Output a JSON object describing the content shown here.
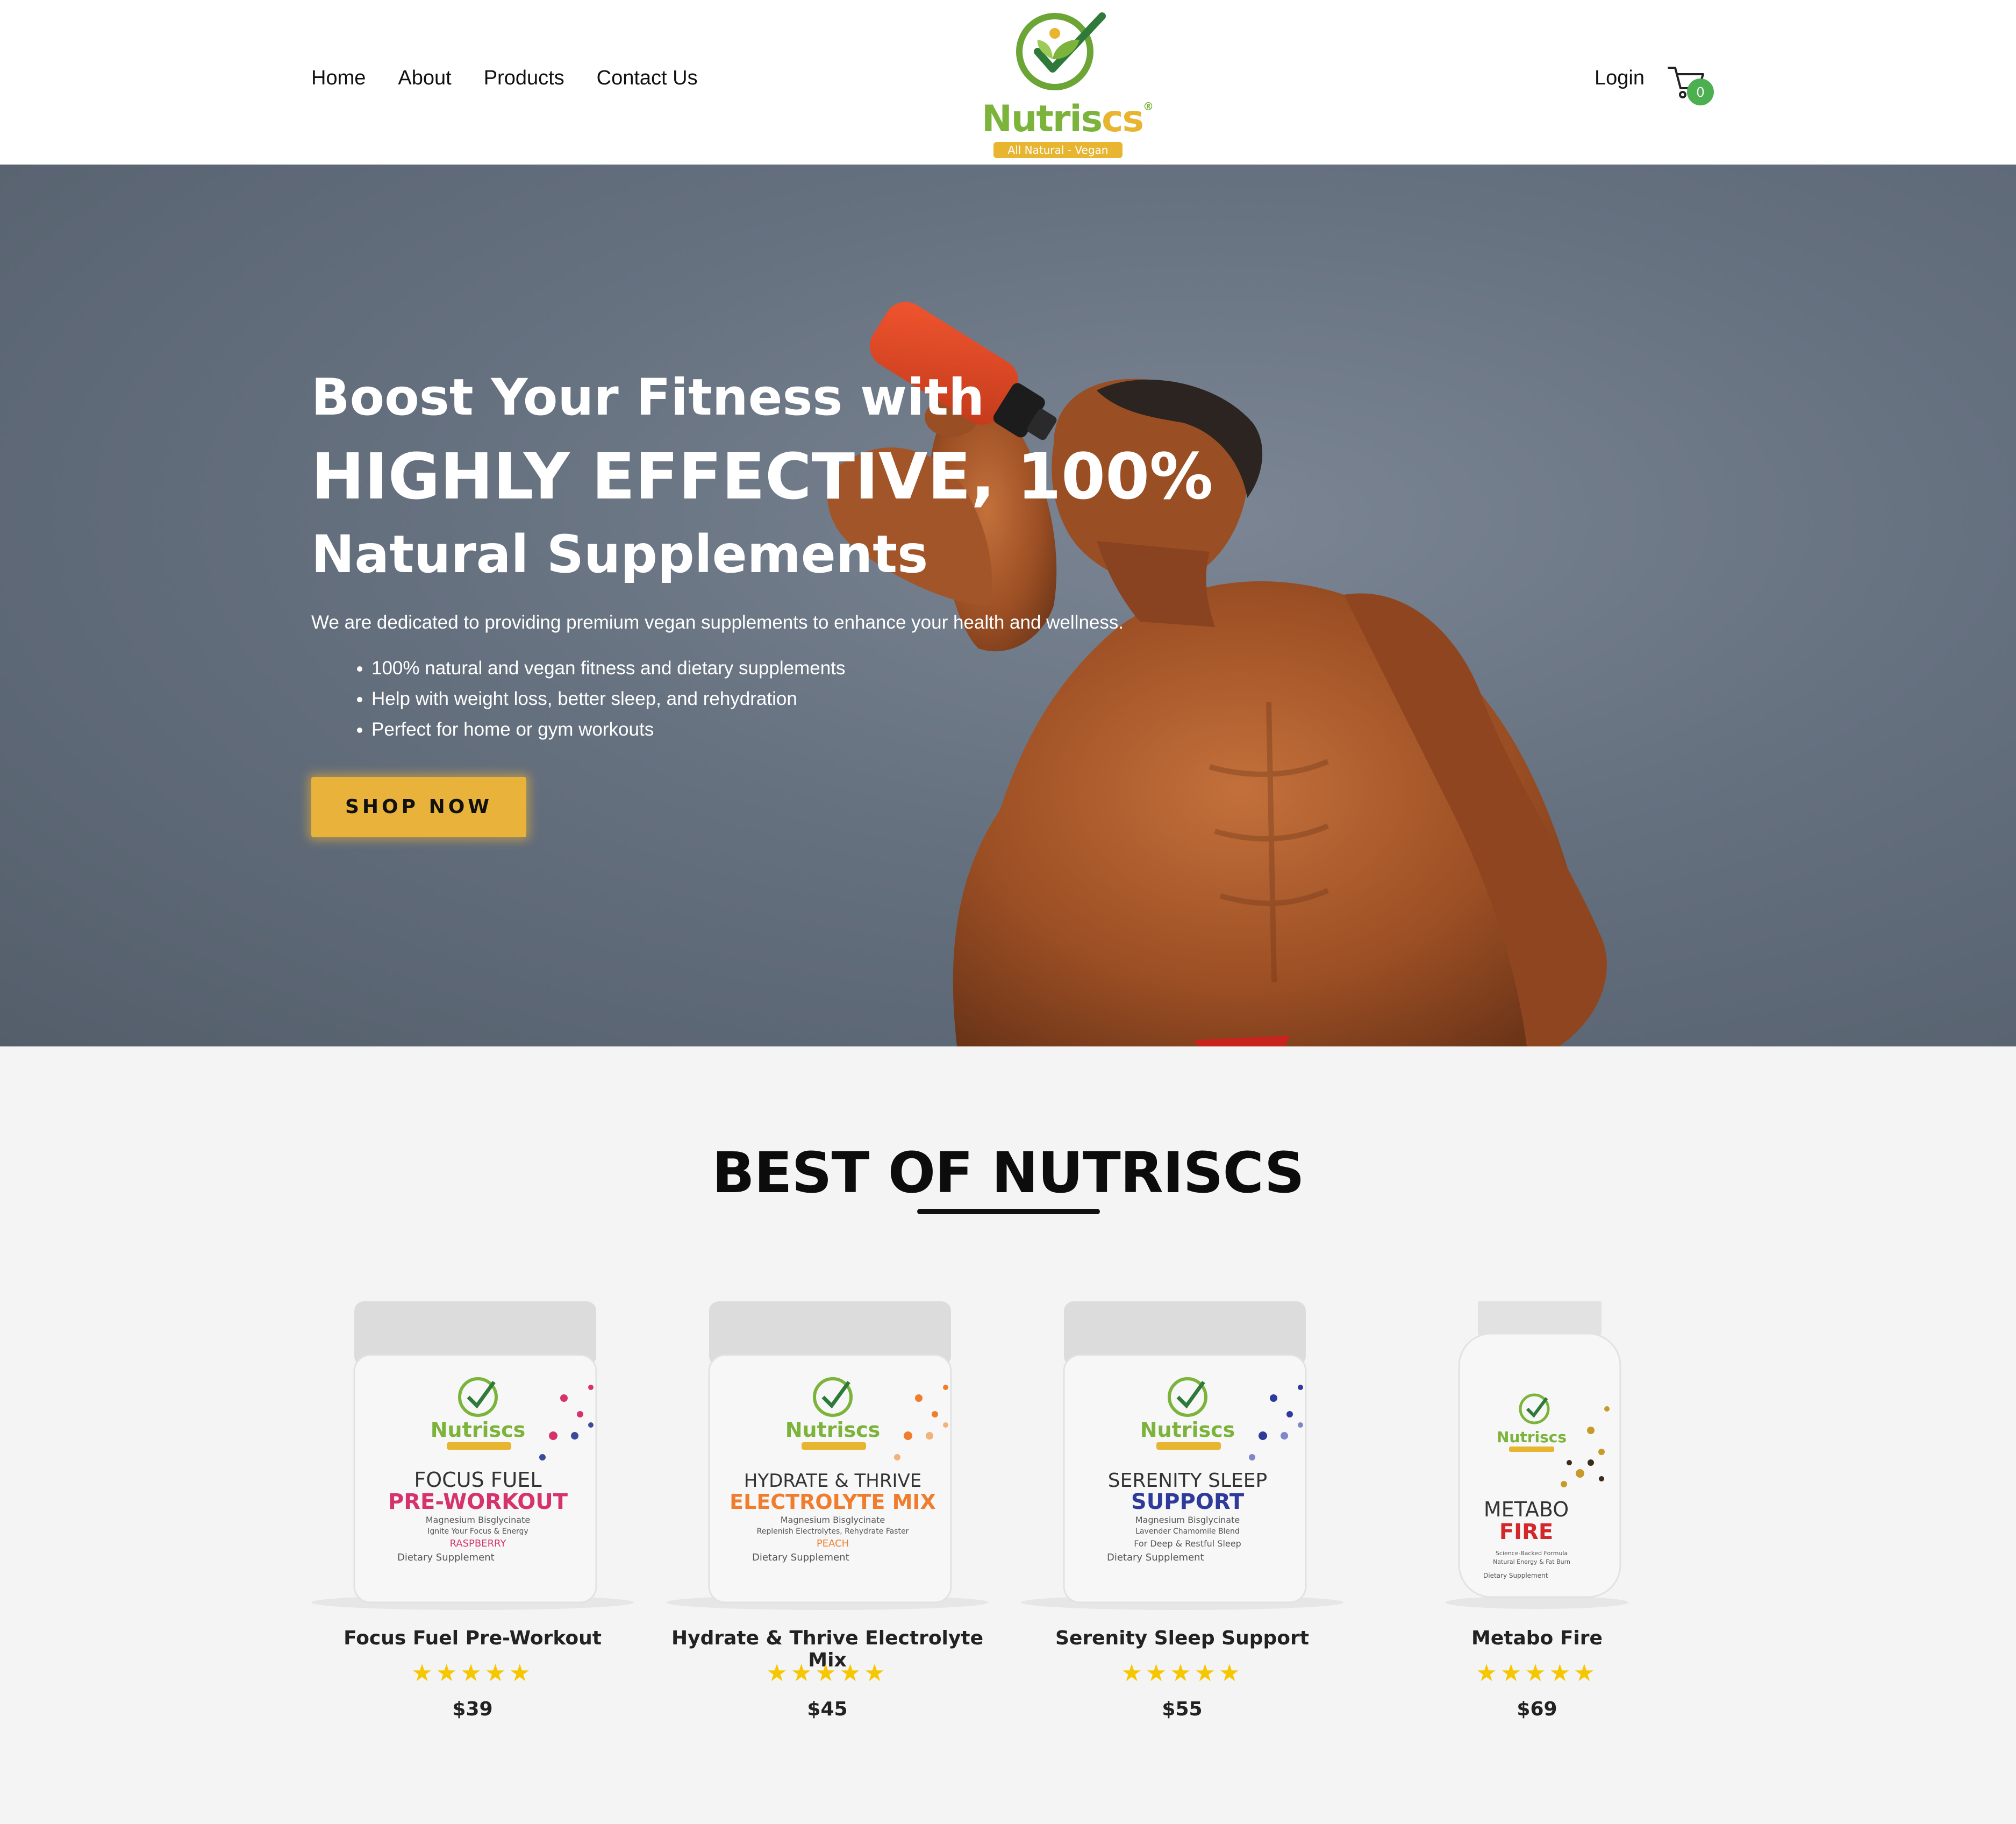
{
  "nav": {
    "items": [
      "Home",
      "About",
      "Products",
      "Contact Us"
    ]
  },
  "logo": {
    "brand_main": "Nutris",
    "brand_accent": "cs",
    "reg": "®",
    "tagline": "All Natural - Vegan"
  },
  "header": {
    "login_label": "Login",
    "cart_count": "0",
    "cart_icon": "cart-icon"
  },
  "hero": {
    "line1": "Boost Your Fitness with",
    "line2": "HIGHLY EFFECTIVE, 100%",
    "line3": "Natural Supplements",
    "description": "We are dedicated to providing premium vegan supplements to enhance your health and wellness.",
    "bullets": [
      "100% natural and vegan fitness and dietary supplements",
      "Help with weight loss, better sleep, and rehydration",
      "Perfect for home or gym workouts"
    ],
    "cta_label": "SHOP NOW"
  },
  "best": {
    "title": "BEST OF NUTRISCS"
  },
  "products": [
    {
      "name": "Focus Fuel Pre-Workout",
      "rating_stars": "★★★★★",
      "price": "$39",
      "label": {
        "line1": "FOCUS FUEL",
        "line2": "PRE-WORKOUT",
        "sub1": "Magnesium Bisglycinate",
        "sub2": "Ignite Your Focus & Energy",
        "flavor": "RASPBERRY",
        "footer": "Dietary Supplement",
        "accent": "#d6336c"
      }
    },
    {
      "name": "Hydrate & Thrive Electrolyte Mix",
      "rating_stars": "★★★★★",
      "price": "$45",
      "label": {
        "line1": "HYDRATE & THRIVE",
        "line2": "ELECTROLYTE MIX",
        "sub1": "Magnesium Bisglycinate",
        "sub2": "Replenish Electrolytes, Rehydrate Faster",
        "flavor": "PEACH",
        "footer": "Dietary Supplement",
        "accent": "#ef7d2d"
      }
    },
    {
      "name": "Serenity Sleep Support",
      "rating_stars": "★★★★★",
      "price": "$55",
      "label": {
        "line1": "SERENITY SLEEP",
        "line2": "SUPPORT",
        "sub1": "Magnesium Bisglycinate",
        "sub2": "Lavender Chamomile Blend",
        "flavor": "For Deep & Restful Sleep",
        "footer": "Dietary Supplement",
        "accent": "#2f3b9a"
      }
    },
    {
      "name": "Metabo Fire",
      "rating_stars": "★★★★★",
      "price": "$69",
      "label": {
        "line1": "METABO",
        "line2": "FIRE",
        "sub1": "Science-Backed Formula",
        "sub2": "Natural Energy & Fat Burn",
        "flavor": "",
        "footer": "Dietary Supplement",
        "accent": "#d3282b"
      }
    }
  ],
  "colors": {
    "brand_green": "#7bb33b",
    "brand_gold": "#e7b530",
    "cta": "#e9b33b",
    "star": "#f6c700",
    "cart_badge": "#4caf50"
  }
}
